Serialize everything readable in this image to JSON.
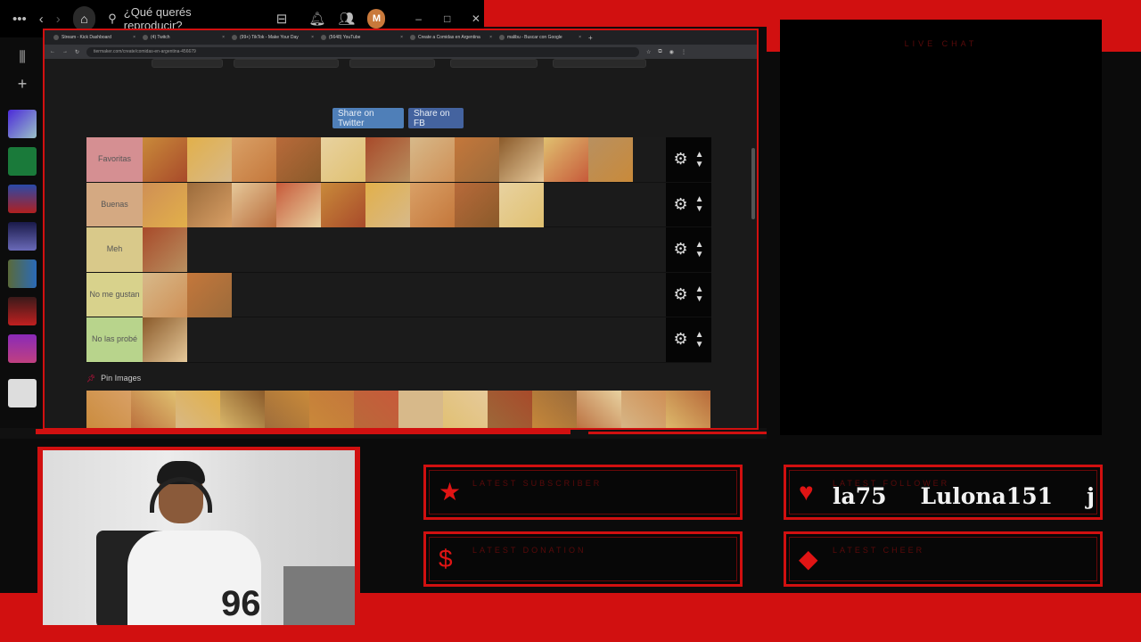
{
  "spotify": {
    "search_placeholder": "¿Qué querés reproducir?",
    "avatar_initial": "M"
  },
  "browser": {
    "tabs": [
      "Stream - Kick Dashboard",
      "(4) Twitch",
      "(99+) TikTok - Make Your Day",
      "(5648) YouTube",
      "Create a Comidas en Argentina",
      "malibu - Buscar con Google"
    ],
    "url": "tiermaker.com/create/comidas-en-argentina-456679"
  },
  "tiermaker": {
    "share_twitter": "Share on Twitter",
    "share_fb": "Share on FB",
    "tiers": [
      {
        "label": "Favoritas",
        "color": "#d58f92",
        "count": 11
      },
      {
        "label": "Buenas",
        "color": "#d4a982",
        "count": 9
      },
      {
        "label": "Meh",
        "color": "#d9c98a",
        "count": 1
      },
      {
        "label": "No me gustan",
        "color": "#d8d28c",
        "count": 2
      },
      {
        "label": "No las probé",
        "color": "#b8d48c",
        "count": 1
      }
    ],
    "pin_title": "Pin Images"
  },
  "overlay": {
    "live_chat": "LIVE CHAT",
    "latest_subscriber": "LATEST SUBSCRIBER",
    "latest_follower": "LATEST FOLLOWER",
    "latest_donation": "LATEST DONATION",
    "latest_cheer": "LATEST CHEER",
    "follower_ticker": [
      "la75",
      "Lulona151",
      "joako"
    ],
    "accent": "#d11010"
  }
}
